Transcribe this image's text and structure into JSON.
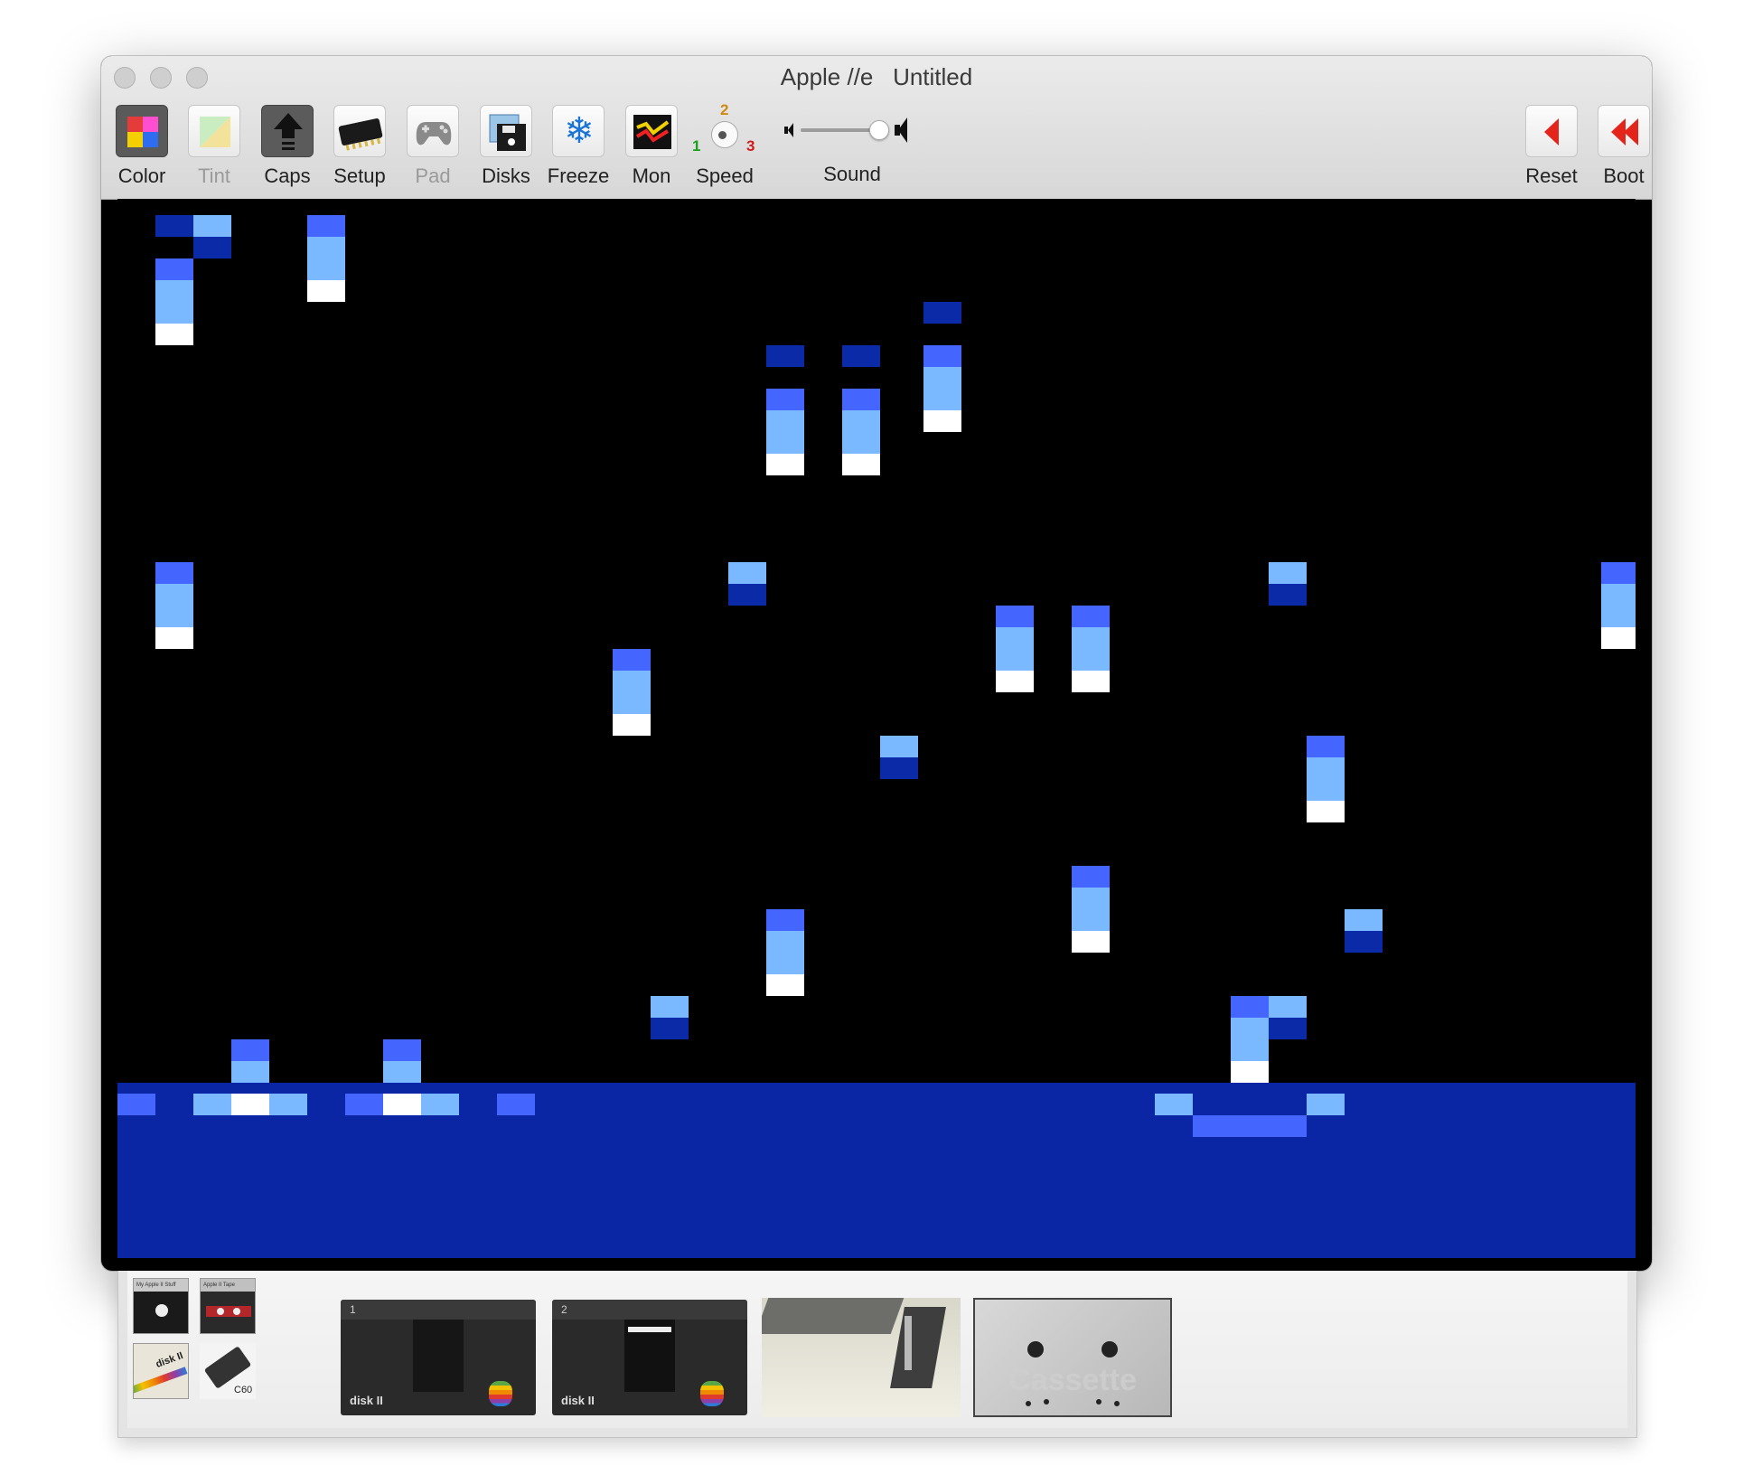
{
  "window": {
    "title": "Apple //e   Untitled"
  },
  "toolbar": {
    "items": [
      {
        "label": "Color",
        "icon": "color-palette-icon",
        "enabled": true
      },
      {
        "label": "Tint",
        "icon": "tint-icon",
        "enabled": false
      },
      {
        "label": "Caps",
        "icon": "caps-lock-icon",
        "enabled": true
      },
      {
        "label": "Setup",
        "icon": "chip-icon",
        "enabled": true
      },
      {
        "label": "Pad",
        "icon": "gamepad-icon",
        "enabled": false
      },
      {
        "label": "Disks",
        "icon": "disks-icon",
        "enabled": true
      },
      {
        "label": "Freeze",
        "icon": "snowflake-icon",
        "enabled": true
      },
      {
        "label": "Mon",
        "icon": "monitor-icon",
        "enabled": true
      }
    ],
    "speed": {
      "label": "Speed",
      "marks": [
        "1",
        "2",
        "3"
      ],
      "mark_colors": [
        "#1aa31a",
        "#d08a12",
        "#d11a1a"
      ]
    },
    "sound": {
      "label": "Sound",
      "volume": 0.85
    },
    "reset": {
      "label": "Reset",
      "icon": "reset-arrow-icon"
    },
    "boot": {
      "label": "Boot",
      "icon": "boot-double-arrow-icon"
    }
  },
  "screen": {
    "palette": {
      "dark": "#0a2aa8",
      "mid": "#4466ff",
      "light": "#7ab8ff",
      "white": "#ffffff",
      "ground": "#0b26a4"
    }
  },
  "drawer": {
    "thumbnails": [
      {
        "name": "my-apple-ii-stuff-thumb",
        "text": "My Apple II Stuff"
      },
      {
        "name": "apple-ii-tape-thumb",
        "text": "Apple II Tape"
      },
      {
        "name": "disk-ii-thumb",
        "text": "disk II"
      },
      {
        "name": "c60-cassette-thumb",
        "text": "C60"
      }
    ],
    "drives": [
      {
        "slot": "1",
        "brand": "disk II"
      },
      {
        "slot": "2",
        "brand": "disk II"
      }
    ],
    "cassette_label": "Cassette"
  }
}
